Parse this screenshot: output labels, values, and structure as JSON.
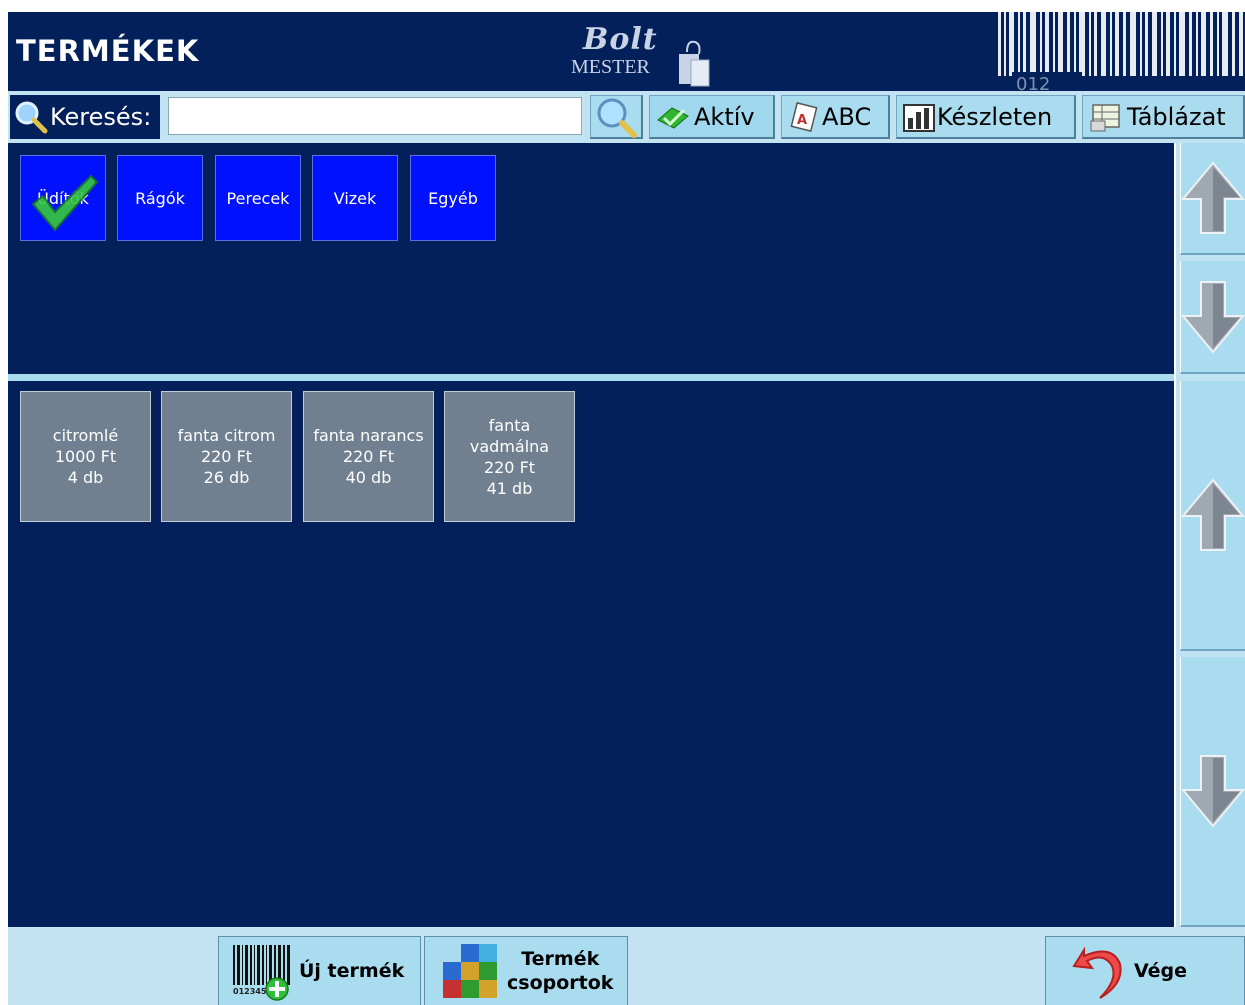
{
  "header": {
    "title": "TERMÉKEK",
    "logo_script": "Bolt",
    "logo_sub": "MESTER",
    "barcode_digits": "012"
  },
  "toolbar": {
    "search_label": "Keresés:",
    "search_value": "",
    "active_label": "Aktív",
    "abc_label": "ABC",
    "stock_label": "Készleten",
    "table_label": "Táblázat"
  },
  "groups": [
    {
      "label": "Üdítők",
      "selected": true
    },
    {
      "label": "Rágók",
      "selected": false
    },
    {
      "label": "Perecek",
      "selected": false
    },
    {
      "label": "Vizek",
      "selected": false
    },
    {
      "label": "Egyéb",
      "selected": false
    }
  ],
  "products": [
    {
      "name": "citromlé",
      "price": "1000 Ft",
      "stock": "4 db"
    },
    {
      "name": "fanta citrom",
      "price": "220 Ft",
      "stock": "26 db"
    },
    {
      "name": "fanta narancs",
      "price": "220 Ft",
      "stock": "40 db"
    },
    {
      "name": "fanta vadmálna",
      "price": "220 Ft",
      "stock": "41 db"
    }
  ],
  "footer": {
    "new_product_label": "Új termék",
    "groups_label_line1": "Termék",
    "groups_label_line2": "csoportok",
    "exit_label": "Vége",
    "barcode_digits": "012345"
  },
  "colors": {
    "navy": "#03205a",
    "light_blue": "#a9dcef",
    "group_blue": "#0011ff",
    "product_gray": "#708090"
  }
}
